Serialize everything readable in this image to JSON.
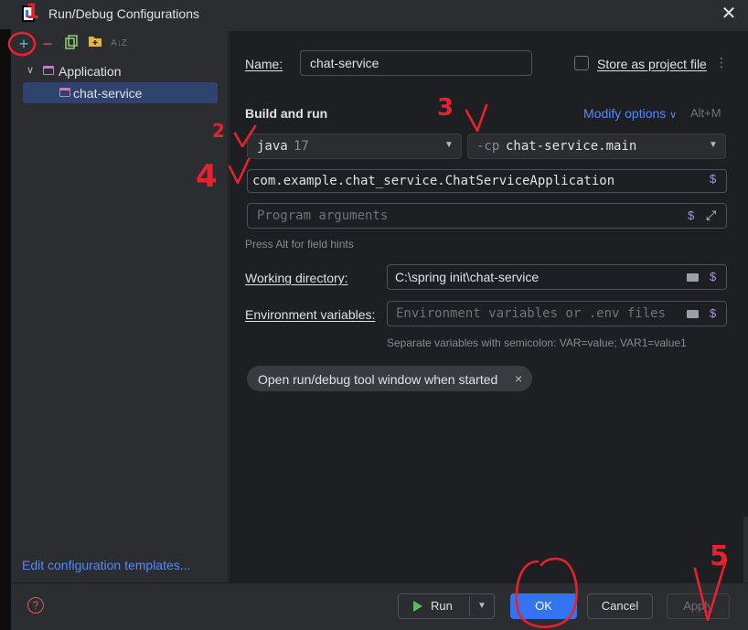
{
  "window": {
    "title": "Run/Debug Configurations",
    "logo_icon": "intellij-logo-icon",
    "close_icon": "close-icon"
  },
  "left_toolbar": {
    "icons": [
      "add-icon",
      "remove-icon",
      "copy-icon",
      "folder-add-icon",
      "sort-alpha-icon"
    ]
  },
  "tree": {
    "group_label": "Application",
    "item_label": "chat-service"
  },
  "edit_templates_link": "Edit configuration templates...",
  "form": {
    "name_label": "Name:",
    "name_value": "chat-service",
    "store_label": "Store as project file",
    "section_title": "Build and run",
    "modify_options": "Modify options",
    "modify_shortcut": "Alt+M",
    "jdk_name": "java",
    "jdk_version": "17",
    "cp_prefix": "-cp",
    "cp_value": "chat-service.main",
    "main_class": "com.example.chat_service.ChatServiceApplication",
    "program_args_placeholder": "Program arguments",
    "alt_hint": "Press Alt for field hints",
    "workdir_label": "Working directory:",
    "workdir_value": "C:\\spring init\\chat-service",
    "env_label": "Environment variables:",
    "env_placeholder": "Environment variables or .env files",
    "env_hint": "Separate variables with semicolon: VAR=value; VAR1=value1",
    "chip_label": "Open run/debug tool window when started",
    "chip_close": "×",
    "dollar": "$"
  },
  "buttons": {
    "run": "Run",
    "ok": "OK",
    "cancel": "Cancel",
    "apply": "Apply",
    "help": "?"
  },
  "annotations": {
    "n1": "1",
    "n2": "2",
    "n3": "3",
    "n4": "4",
    "n5": "5"
  },
  "colors": {
    "accent": "#3574f0",
    "annotation": "#e8212e",
    "link": "#548af7",
    "background": "#1e1f22"
  }
}
